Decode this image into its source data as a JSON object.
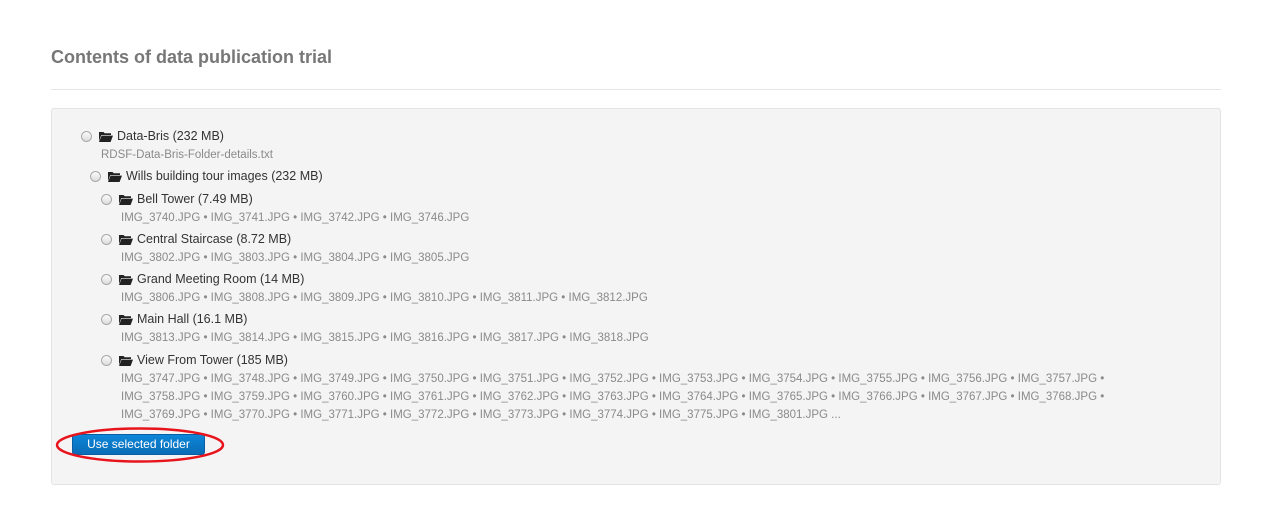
{
  "page": {
    "title": "Contents of data publication trial"
  },
  "tree": {
    "root": {
      "label": "Data-Bris (232 MB)",
      "file": "RDSF-Data-Bris-Folder-details.txt"
    },
    "sub": {
      "label": "Wills building tour images (232 MB)"
    },
    "folders": [
      {
        "label": "Bell Tower (7.49 MB)",
        "files": [
          "IMG_3740.JPG • IMG_3741.JPG • IMG_3742.JPG • IMG_3746.JPG"
        ]
      },
      {
        "label": "Central Staircase (8.72 MB)",
        "files": [
          "IMG_3802.JPG • IMG_3803.JPG • IMG_3804.JPG • IMG_3805.JPG"
        ]
      },
      {
        "label": "Grand Meeting Room (14 MB)",
        "files": [
          "IMG_3806.JPG • IMG_3808.JPG • IMG_3809.JPG • IMG_3810.JPG • IMG_3811.JPG • IMG_3812.JPG"
        ]
      },
      {
        "label": "Main Hall (16.1 MB)",
        "files": [
          "IMG_3813.JPG • IMG_3814.JPG • IMG_3815.JPG • IMG_3816.JPG • IMG_3817.JPG • IMG_3818.JPG"
        ]
      },
      {
        "label": "View From Tower (185 MB)",
        "files": [
          "IMG_3747.JPG • IMG_3748.JPG • IMG_3749.JPG • IMG_3750.JPG • IMG_3751.JPG • IMG_3752.JPG • IMG_3753.JPG • IMG_3754.JPG • IMG_3755.JPG • IMG_3756.JPG • IMG_3757.JPG •",
          "IMG_3758.JPG • IMG_3759.JPG • IMG_3760.JPG • IMG_3761.JPG • IMG_3762.JPG • IMG_3763.JPG • IMG_3764.JPG • IMG_3765.JPG • IMG_3766.JPG • IMG_3767.JPG • IMG_3768.JPG •",
          "IMG_3769.JPG • IMG_3770.JPG • IMG_3771.JPG • IMG_3772.JPG • IMG_3773.JPG • IMG_3774.JPG • IMG_3775.JPG • IMG_3801.JPG ..."
        ]
      }
    ]
  },
  "actions": {
    "use_selected_label": "Use selected folder"
  },
  "colors": {
    "button": "#0a76c6",
    "highlight": "#e8141c",
    "panel_bg": "#f4f4f4"
  }
}
